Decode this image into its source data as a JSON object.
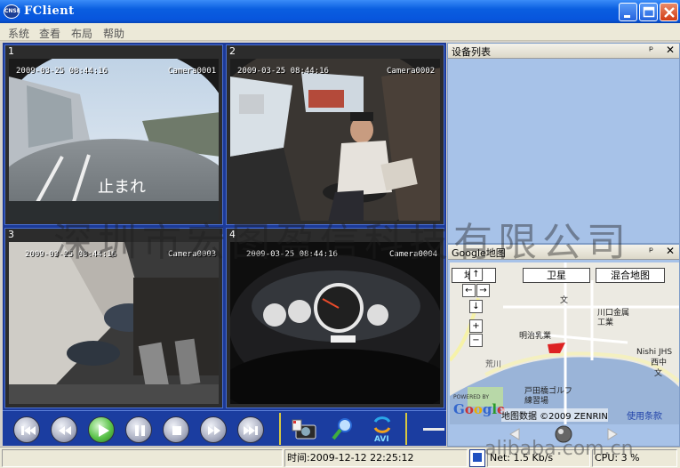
{
  "window": {
    "title": "FClient",
    "icon_text": "CNSE",
    "title_bar_color": "#0a5ee0"
  },
  "menu": [
    "系统",
    "查看",
    "布局",
    "帮助"
  ],
  "video": {
    "cells": [
      {
        "index": "1",
        "timestamp": "2009-03-25 08:44:16",
        "camera": "Camera0001"
      },
      {
        "index": "2",
        "timestamp": "2009-03-25 08:44:16",
        "camera": "Camera0002"
      },
      {
        "index": "3",
        "timestamp": "2009-03-25 08:44:16",
        "camera": "Camera0003"
      },
      {
        "index": "4",
        "timestamp": "2009-03-25 08:44:16",
        "camera": "Camera0004"
      }
    ],
    "road_marking": "止まれ"
  },
  "controls": {
    "buttons": [
      "skip-to-start-icon",
      "rewind-icon",
      "play-icon",
      "pause-icon",
      "stop-icon",
      "fast-forward-icon",
      "skip-to-end-icon"
    ],
    "avi_label": "AVI"
  },
  "device_panel": {
    "title": "设备列表",
    "pin": "ᵖ",
    "close": "✕"
  },
  "map_panel": {
    "title": "Google地图",
    "pin": "ᵖ",
    "close": "✕",
    "type_buttons": [
      "地图",
      "卫星",
      "混合地图"
    ],
    "nav": {
      "up": "↑",
      "left": "←",
      "right": "→",
      "down": "↓",
      "zoom_in": "+",
      "zoom_out": "−"
    },
    "labels": {
      "wen1": "文",
      "kawaguchi": "川口金属\n工業",
      "meiji": "明治乳業",
      "nishi": "Nishi JHS",
      "nishinaka": "西中",
      "wen2": "文",
      "golf": "戸田橋ゴルフ\n練習場",
      "river": "荒川"
    },
    "powered_by": "POWERED BY",
    "google": "Google",
    "copyright": "地图数据 ©2009 ZENRIN",
    "terms": "使用条款"
  },
  "status": {
    "time": "时间:2009-12-12  22:25:12",
    "net": "Net: 1.5 Kb/s",
    "cpu": "CPU: 3 %"
  },
  "watermark": {
    "company": "深圳市宏图盈信科技有限公司",
    "site": "alibaba.com.cn"
  }
}
